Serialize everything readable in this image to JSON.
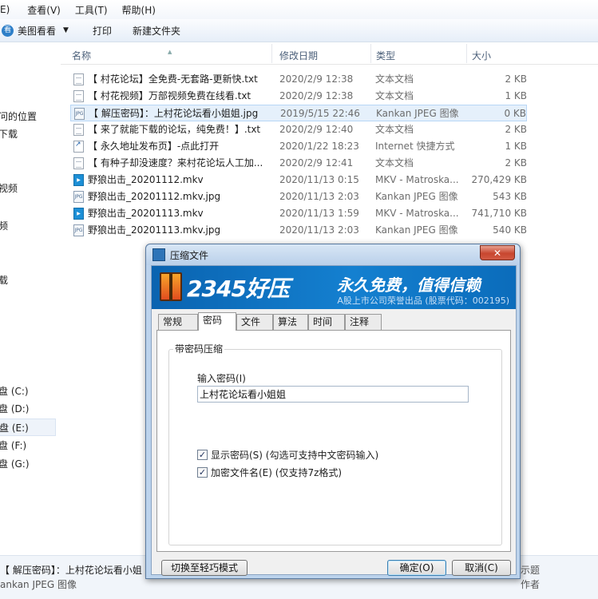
{
  "menubar": {
    "items": [
      "E)",
      "查看(V)",
      "工具(T)",
      "帮助(H)"
    ]
  },
  "toolbar": {
    "viewer": "美图看看",
    "print": "打印",
    "new_folder": "新建文件夹"
  },
  "nav": {
    "items": [
      "问的位置",
      "下载",
      "视频",
      "频",
      "载",
      "盘 (C:)",
      "盘 (D:)",
      "盘 (E:)",
      "盘 (F:)",
      "盘 (G:)"
    ]
  },
  "columns": {
    "name": "名称",
    "date": "修改日期",
    "type": "类型",
    "size": "大小"
  },
  "files": [
    {
      "name": "【 村花论坛】全免费-无套路-更新快.txt",
      "date": "2020/2/9 12:38",
      "type": "文本文档",
      "size": "2 KB",
      "icon": "txt"
    },
    {
      "name": "【 村花视频】万部视频免费在线看.txt",
      "date": "2020/2/9 12:38",
      "type": "文本文档",
      "size": "1 KB",
      "icon": "txt"
    },
    {
      "name": "【 解压密码】：上村花论坛看小姐姐.jpg",
      "date": "2019/5/15 22:46",
      "type": "Kankan JPEG 图像",
      "size": "0 KB",
      "icon": "jpg"
    },
    {
      "name": "【 来了就能下载的论坛，纯免费！】.txt",
      "date": "2020/2/9 12:40",
      "type": "文本文档",
      "size": "2 KB",
      "icon": "txt"
    },
    {
      "name": "【 永久地址发布页】-点此打开",
      "date": "2020/1/22 18:23",
      "type": "Internet 快捷方式",
      "size": "1 KB",
      "icon": "url"
    },
    {
      "name": "【 有种子却没速度？来村花论坛人工加...",
      "date": "2020/2/9 12:41",
      "type": "文本文档",
      "size": "2 KB",
      "icon": "txt"
    },
    {
      "name": "野狼出击_20201112.mkv",
      "date": "2020/11/13 0:15",
      "type": "MKV - Matroska...",
      "size": "270,429 KB",
      "icon": "mkv"
    },
    {
      "name": "野狼出击_20201112.mkv.jpg",
      "date": "2020/11/13 2:03",
      "type": "Kankan JPEG 图像",
      "size": "543 KB",
      "icon": "jpg"
    },
    {
      "name": "野狼出击_20201113.mkv",
      "date": "2020/11/13 1:59",
      "type": "MKV - Matroska...",
      "size": "741,710 KB",
      "icon": "mkv"
    },
    {
      "name": "野狼出击_20201113.mkv.jpg",
      "date": "2020/11/13 2:03",
      "type": "Kankan JPEG 图像",
      "size": "540 KB",
      "icon": "jpg"
    }
  ],
  "status": {
    "filename": "【 解压密码】：上村花论坛看小姐",
    "filetype": "ankan JPEG 图像",
    "right1": "示题",
    "right2": "作者"
  },
  "dialog": {
    "title": "压缩文件",
    "close": "✕",
    "brand": "2345好压",
    "slogan": "永久免费，值得信赖",
    "subtag": "A股上市公司荣誉出品 (股票代码：002195)",
    "tabs": [
      "常规",
      "密码",
      "文件",
      "算法",
      "时间",
      "注释"
    ],
    "group_label": "带密码压缩",
    "password_label": "输入密码(I)",
    "password_value": "上村花论坛看小姐姐",
    "show_password": "显示密码(S)  (勾选可支持中文密码输入)",
    "encrypt_names": "加密文件名(E)  (仅支持7z格式)",
    "mode_button": "切换至轻巧模式",
    "ok": "确定(O)",
    "cancel": "取消(C)"
  }
}
